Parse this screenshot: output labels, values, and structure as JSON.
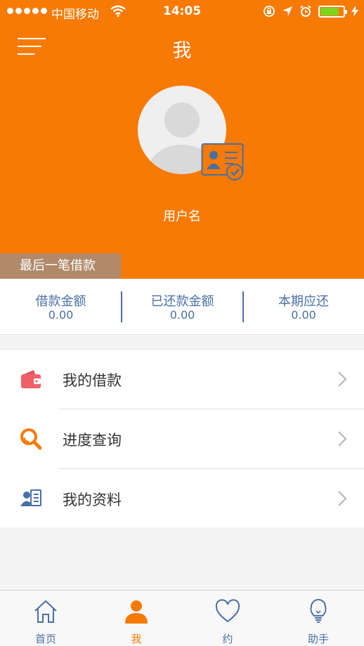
{
  "status_bar": {
    "carrier": "中国移动",
    "time": "14:05",
    "battery_color": "#7ed321"
  },
  "header": {
    "title": "我",
    "menu_icon": "hamburger-menu-icon",
    "username": "用户名",
    "last_loan_tag": "最后一笔借款",
    "accent_color": "#f77a04"
  },
  "stats": [
    {
      "label": "借款金额",
      "value": "0.00"
    },
    {
      "label": "已还款金额",
      "value": "0.00"
    },
    {
      "label": "本期应还",
      "value": "0.00"
    }
  ],
  "menu": [
    {
      "label": "我的借款",
      "icon": "wallet-icon"
    },
    {
      "label": "进度查询",
      "icon": "magnifier-icon"
    },
    {
      "label": "我的资料",
      "icon": "profile-card-icon"
    }
  ],
  "tabs": [
    {
      "label": "首页",
      "icon": "home-icon",
      "active": false
    },
    {
      "label": "我",
      "icon": "person-icon",
      "active": true
    },
    {
      "label": "约",
      "icon": "heart-icon",
      "active": false
    },
    {
      "label": "助手",
      "icon": "lightbulb-icon",
      "active": false
    }
  ]
}
